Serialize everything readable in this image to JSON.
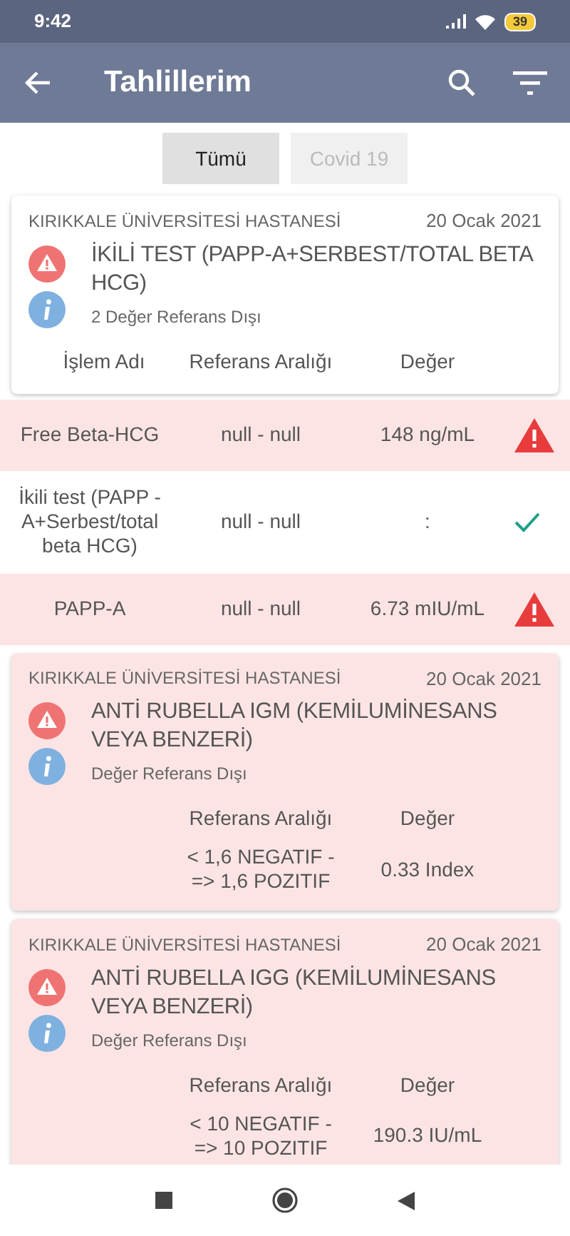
{
  "status_bar": {
    "time": "9:42",
    "battery": "39"
  },
  "app_bar": {
    "title": "Tahlillerim"
  },
  "tabs": [
    {
      "label": "Tümü",
      "selected": true
    },
    {
      "label": "Covid 19",
      "selected": false
    }
  ],
  "results": [
    {
      "kind": "expanded",
      "out_of_range": false,
      "hospital": "KIRIKKALE ÜNİVERSİTESİ HASTANESİ",
      "date": "20 Ocak 2021",
      "title": "İKİLİ TEST (PAPP-A+SERBEST/TOTAL BETA HCG)",
      "status": "2 Değer Referans Dışı",
      "columns": [
        "İşlem Adı",
        "Referans Aralığı",
        "Değer"
      ],
      "rows": [
        {
          "name": "Free Beta-HCG",
          "range": "null - null",
          "value": "148 ng/mL",
          "abnormal": true
        },
        {
          "name": "İkili test (PAPP -A+Serbest/total beta HCG)",
          "range": "null - null",
          "value": ":",
          "abnormal": false
        },
        {
          "name": "PAPP-A",
          "range": "null - null",
          "value": "6.73 mIU/mL",
          "abnormal": true
        }
      ]
    },
    {
      "kind": "compact",
      "out_of_range": true,
      "hospital": "KIRIKKALE ÜNİVERSİTESİ HASTANESİ",
      "date": "20 Ocak 2021",
      "title": "ANTİ RUBELLA IGM (KEMİLUMİNESANS VEYA BENZERİ)",
      "status": "Değer Referans Dışı",
      "columns": [
        "Referans Aralığı",
        "Değer"
      ],
      "rows": [
        {
          "range": "< 1,6 NEGATIF - => 1,6 POZITIF",
          "value": "0.33 Index"
        }
      ]
    },
    {
      "kind": "compact",
      "out_of_range": true,
      "hospital": "KIRIKKALE ÜNİVERSİTESİ HASTANESİ",
      "date": "20 Ocak 2021",
      "title": "ANTİ RUBELLA IGG (KEMİLUMİNESANS VEYA BENZERİ)",
      "status": "Değer Referans Dışı",
      "columns": [
        "Referans Aralığı",
        "Değer"
      ],
      "rows": [
        {
          "range": "< 10 NEGATIF - => 10 POZITIF",
          "value": "190.3 IU/mL"
        }
      ]
    }
  ]
}
